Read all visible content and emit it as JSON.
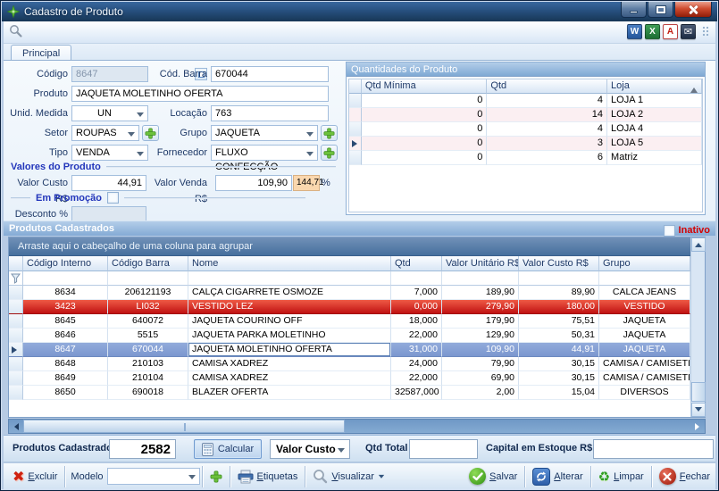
{
  "window": {
    "title": "Cadastro de Produto"
  },
  "toolbar": {
    "icons": [
      {
        "name": "export-word",
        "glyph": "W"
      },
      {
        "name": "export-excel",
        "glyph": "X"
      },
      {
        "name": "export-pdf",
        "glyph": "A"
      },
      {
        "name": "export-email",
        "glyph": "✉"
      }
    ]
  },
  "tab": {
    "label": "Principal"
  },
  "form": {
    "codigo_label": "Código",
    "codigo_value": "8647",
    "cod_barra_label": "Cód. Barra",
    "cod_barra_value": "670044",
    "produto_label": "Produto",
    "produto_value": "JAQUETA MOLETINHO OFERTA",
    "unid_medida_label": "Unid. Medida",
    "unid_medida_value": "UN",
    "locacao_label": "Locação",
    "locacao_value": "763",
    "setor_label": "Setor",
    "setor_value": "ROUPAS",
    "grupo_label": "Grupo",
    "grupo_value": "JAQUETA",
    "tipo_label": "Tipo",
    "tipo_value": "VENDA",
    "fornecedor_label": "Fornecedor",
    "fornecedor_value": "FLUXO CONFECÇÃO",
    "valores_header": "Valores do Produto",
    "valor_custo_label": "Valor Custo R$",
    "valor_custo_value": "44,91",
    "valor_venda_label": "Valor Venda R$",
    "valor_venda_value": "109,90",
    "margem_value": "144,71",
    "percent_sign": "%",
    "em_promocao_label": "Em Promoção",
    "em_promocao_checked": false,
    "desconto_label": "Desconto %",
    "desconto_value": ""
  },
  "quantidades": {
    "title": "Quantidades do Produto",
    "cols": [
      "Qtd Mínima",
      "Qtd",
      "Loja"
    ],
    "rows": [
      [
        "0",
        "4",
        "LOJA 1"
      ],
      [
        "0",
        "14",
        "LOJA 2"
      ],
      [
        "0",
        "4",
        "LOJA 4"
      ],
      [
        "0",
        "3",
        "LOJA 5"
      ],
      [
        "0",
        "6",
        "Matriz"
      ]
    ],
    "selected_row": 3,
    "sorted_column": "Loja"
  },
  "produtos": {
    "header": "Produtos Cadastrados",
    "inativo_label": "Inativo",
    "inativo_checked": false,
    "group_hint": "Arraste aqui o cabeçalho de uma coluna para agrupar",
    "cols": [
      "Código Interno",
      "Código Barra",
      "Nome",
      "Qtd",
      "Valor Unitário R$",
      "Valor Custo R$",
      "Grupo"
    ],
    "rows": [
      [
        "8634",
        "206121193",
        "CALÇA CIGARRETE OSMOZE",
        "7,000",
        "189,90",
        "89,90",
        "CALCA JEANS"
      ],
      [
        "3423",
        "LI032",
        "VESTIDO LEZ",
        "0,000",
        "279,90",
        "180,00",
        "VESTIDO"
      ],
      [
        "8645",
        "640072",
        "JAQUETA COURINO OFF",
        "18,000",
        "179,90",
        "75,51",
        "JAQUETA"
      ],
      [
        "8646",
        "5515",
        "JAQUETA PARKA MOLETINHO",
        "22,000",
        "129,90",
        "50,31",
        "JAQUETA"
      ],
      [
        "8647",
        "670044",
        "JAQUETA MOLETINHO OFERTA",
        "31,000",
        "109,90",
        "44,91",
        "JAQUETA"
      ],
      [
        "8648",
        "210103",
        "CAMISA XADREZ",
        "24,000",
        "79,90",
        "30,15",
        "CAMISA / CAMISETE"
      ],
      [
        "8649",
        "210104",
        "CAMISA XADREZ",
        "22,000",
        "69,90",
        "30,15",
        "CAMISA / CAMISETE"
      ],
      [
        "8650",
        "690018",
        "BLAZER OFERTA",
        "32587,000",
        "2,00",
        "15,04",
        "DIVERSOS"
      ]
    ],
    "selected_row": 4,
    "alert_row": 1
  },
  "status_bar": {
    "produtos_cadastrados_label": "Produtos Cadastrados",
    "produtos_cadastrados_value": "2582",
    "calcular_label": "Calcular",
    "valor_custo_option": "Valor Custo",
    "qtd_total_label": "Qtd Total",
    "qtd_total_value": "",
    "capital_label": "Capital em Estoque R$",
    "capital_value": ""
  },
  "action_bar": {
    "excluir": "Excluir",
    "modelo_label": "Modelo",
    "modelo_value": "",
    "etiquetas": "Etiquetas",
    "visualizar": "Visualizar",
    "salvar": "Salvar",
    "alterar": "Alterar",
    "limpar": "Limpar",
    "fechar": "Fechar"
  },
  "colors": {
    "selected_row": "#7e99d2",
    "alert_row": "#c01212",
    "inativo_text": "#d40000",
    "margem_bg": "#fad7ae",
    "title_bar": "#1e3f68"
  }
}
